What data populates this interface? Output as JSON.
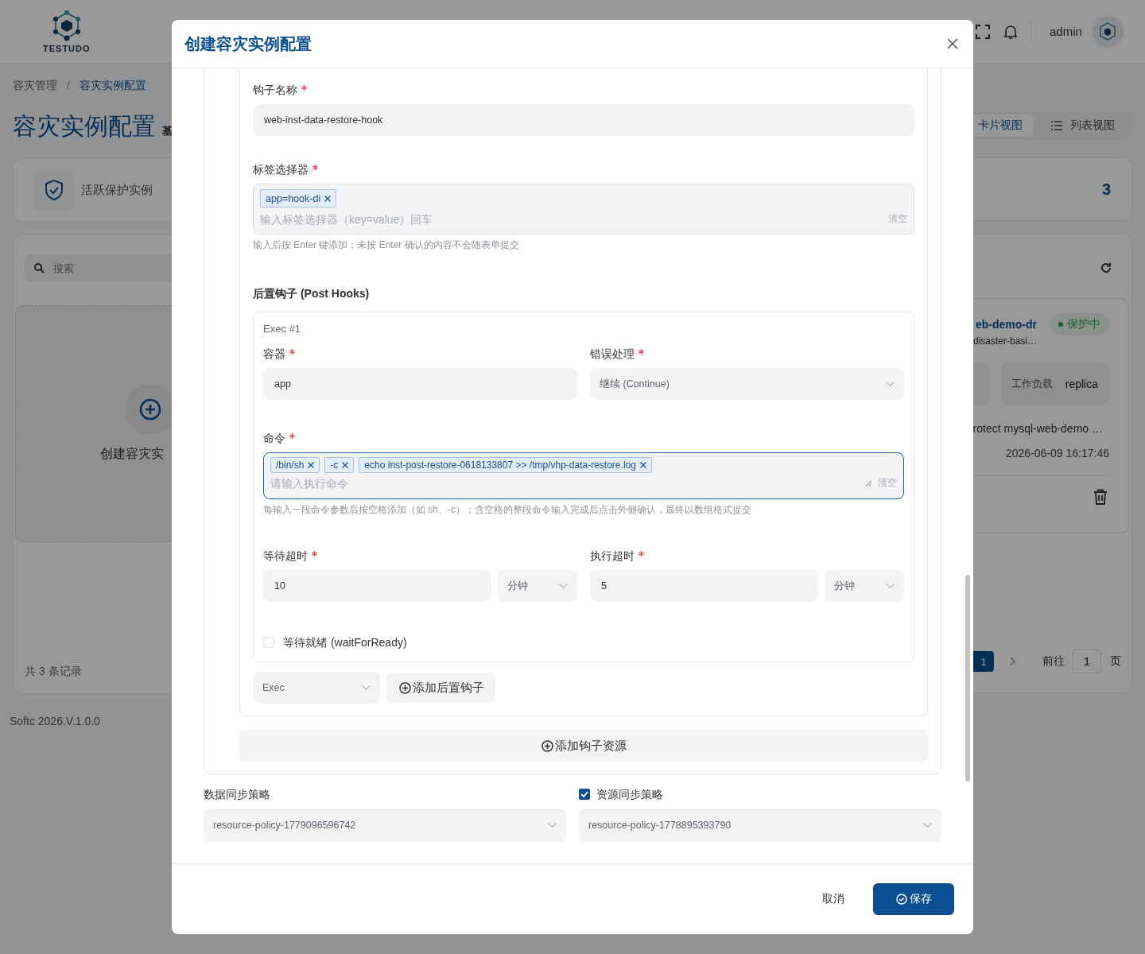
{
  "header": {
    "logo_text": "TESTUDO",
    "user": "admin"
  },
  "breadcrumb": {
    "separator": "/",
    "items": [
      {
        "label": "容灾管理",
        "current": false
      },
      {
        "label": "容灾实例配置",
        "current": true
      }
    ]
  },
  "page": {
    "title": "容灾实例配置",
    "subtitle": "基"
  },
  "view_toggle": [
    {
      "label": "卡片视图",
      "selected": true
    },
    {
      "label": "列表视图",
      "selected": false
    }
  ],
  "stats": {
    "label": "活跃保护实例",
    "value": "3"
  },
  "search": {
    "placeholder": "搜索"
  },
  "create_card": {
    "label": "创建容灾实"
  },
  "instance_card": {
    "name": "eb-demo-dr",
    "status": "保护中",
    "description": "disaster-basi…",
    "workload_label": "工作负载",
    "workload_value": "replica",
    "command": "rotect mysql-web-demo …",
    "time": "2026-06-09 16:17:46"
  },
  "pagination": {
    "total": "共 3 条记录",
    "pages": [
      {
        "label": "1",
        "selected": true
      }
    ],
    "goto_label": "前往",
    "goto_value": "1",
    "goto_suffix": "页"
  },
  "version": "Softc 2026.V.1.0.0",
  "dialog": {
    "title": "创建容灾实例配置",
    "hook_name": {
      "label": "钩子名称",
      "required": true,
      "value": "web-inst-data-restore-hook"
    },
    "label_selector": {
      "label": "标签选择器",
      "required": true,
      "tags": [
        "app=hook-di"
      ],
      "placeholder": "输入标签选择器（key=value）回车",
      "clear": "清空",
      "hint": "输入后按 Enter 键添加；未按 Enter 确认的内容不会随表单提交"
    },
    "post_hooks": {
      "title": "后置钩子 (Post Hooks)",
      "execs": [
        {
          "title": "Exec #1",
          "container": {
            "label": "容器",
            "required": true,
            "value": "app"
          },
          "on_error": {
            "label": "错误处理",
            "required": true,
            "value": "继续 (Continue)"
          },
          "command": {
            "label": "命令",
            "required": true,
            "focused": true,
            "tags": [
              "/bin/sh",
              "-c",
              "echo inst-post-restore-0618133807 >> /tmp/vhp-data-restore.log"
            ],
            "placeholder": "请输入执行命令",
            "clear": "清空",
            "hint": "每输入一段命令参数后按空格添加（如 sh、-c）；含空格的整段命令输入完成后点击外侧确认，最终以数组格式提交"
          },
          "wait_timeout": {
            "label": "等待超时",
            "required": true,
            "value": "10",
            "unit": "分钟"
          },
          "exec_timeout": {
            "label": "执行超时",
            "required": true,
            "value": "5",
            "unit": "分钟"
          },
          "wait_for_ready": {
            "label": "等待就绪 (waitForReady)",
            "checked": false
          }
        }
      ],
      "type_select": "Exec",
      "add_button": "添加后置钩子"
    },
    "add_resource_button": "添加钩子资源",
    "data_sync": {
      "label": "数据同步策略",
      "value": "resource-policy-1779096596742"
    },
    "resource_sync": {
      "label": "资源同步策略",
      "checked": true,
      "value": "resource-policy-1778895393790"
    },
    "buttons": {
      "cancel": "取消",
      "save": "保存"
    }
  }
}
